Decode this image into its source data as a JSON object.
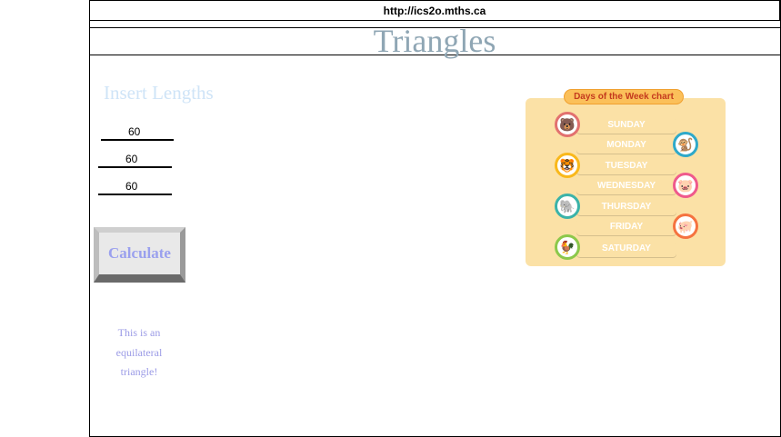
{
  "browser": {
    "url": "http://ics2o.mths.ca"
  },
  "page": {
    "title": "Triangles"
  },
  "form": {
    "heading": "Insert Lengths",
    "inputs": [
      {
        "value": "60"
      },
      {
        "value": "60"
      },
      {
        "value": "60"
      }
    ],
    "calculate_label": "Calculate",
    "result_lines": [
      "This is an",
      "equilateral",
      "triangle!"
    ]
  },
  "chart": {
    "title": "Days of the Week chart",
    "days": [
      {
        "label": "SUNDAY",
        "color": "#e2716f",
        "icon": "bear-icon"
      },
      {
        "label": "MONDAY",
        "color": "#2fa9c9",
        "icon": "monkey-icon"
      },
      {
        "label": "TUESDAY",
        "color": "#f9b81b",
        "icon": "tiger-icon"
      },
      {
        "label": "WEDNESDAY",
        "color": "#ef5a8c",
        "icon": "pig-icon"
      },
      {
        "label": "THURSDAY",
        "color": "#3bb3a9",
        "icon": "elephant-icon"
      },
      {
        "label": "FRIDAY",
        "color": "#f57340",
        "icon": "pig-icon"
      },
      {
        "label": "SATURDAY",
        "color": "#8cc84b",
        "icon": "rooster-icon"
      }
    ]
  }
}
